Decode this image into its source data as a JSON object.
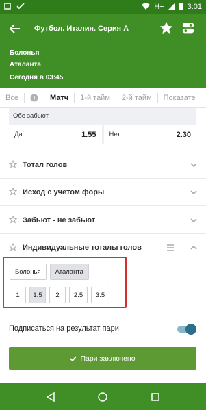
{
  "status_bar": {
    "network": "H+",
    "time": "3:01"
  },
  "header": {
    "title": "Футбол. Италия. Серия А",
    "home_team": "Болонья",
    "away_team": "Аталанта",
    "date": "Сегодня в 03:45"
  },
  "tabs": [
    {
      "label": "Все",
      "active": false
    },
    {
      "label": "Матч",
      "active": true
    },
    {
      "label": "1-й тайм",
      "active": false
    },
    {
      "label": "2-й тайм",
      "active": false
    },
    {
      "label": "Показате",
      "active": false
    }
  ],
  "market": {
    "title": "Обе забьют",
    "yes_label": "Да",
    "yes_odd": "1.55",
    "no_label": "Нет",
    "no_odd": "2.30"
  },
  "accordion": [
    {
      "label": "Тотал голов"
    },
    {
      "label": "Исход с учетом форы"
    },
    {
      "label": "Забьют - не забьют"
    },
    {
      "label": "Индивидуальные тоталы голов"
    }
  ],
  "individual_totals": {
    "teams": [
      "Болонья",
      "Аталанта"
    ],
    "lines": [
      "1",
      "1.5",
      "2",
      "2.5",
      "3.5"
    ]
  },
  "subscribe_label": "Подписаться на результат пари",
  "confirm_label": "Пари заключено",
  "colors": {
    "header_green": "#3f8e26",
    "confirm_green": "#5e9a33",
    "highlight_red": "#d32f2f"
  }
}
